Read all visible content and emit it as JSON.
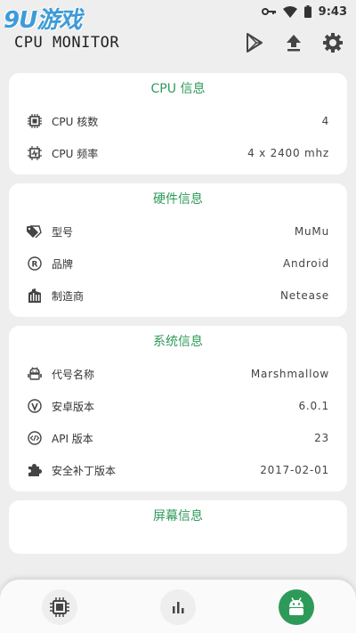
{
  "status_bar": {
    "time": "9:43",
    "icons": [
      "key-icon",
      "wifi-icon",
      "battery-icon"
    ]
  },
  "watermark": {
    "text": "9U游戏"
  },
  "app_bar": {
    "title": "CPU MONITOR",
    "actions": [
      "play-store-icon",
      "upload-icon",
      "settings-icon"
    ]
  },
  "cards": {
    "cpu": {
      "title": "CPU 信息",
      "rows": [
        {
          "icon": "cpu-chip-icon",
          "label": "CPU 核数",
          "value": "4"
        },
        {
          "icon": "cpu-frequency-icon",
          "label": "CPU 频率",
          "value": "4 x 2400 mhz"
        }
      ]
    },
    "hardware": {
      "title": "硬件信息",
      "rows": [
        {
          "icon": "tag-icon",
          "label": "型号",
          "value": "MuMu"
        },
        {
          "icon": "registered-icon",
          "label": "品牌",
          "value": "Android"
        },
        {
          "icon": "building-icon",
          "label": "制造商",
          "value": "Netease"
        }
      ]
    },
    "system": {
      "title": "系统信息",
      "rows": [
        {
          "icon": "android-icon",
          "label": "代号名称",
          "value": "Marshmallow"
        },
        {
          "icon": "android-version-icon",
          "label": "安卓版本",
          "value": "6.0.1"
        },
        {
          "icon": "code-icon",
          "label": "API 版本",
          "value": "23"
        },
        {
          "icon": "puzzle-icon",
          "label": "安全补丁版本",
          "value": "2017-02-01"
        }
      ]
    },
    "screen": {
      "title": "屏幕信息"
    }
  },
  "bottom_nav": {
    "items": [
      {
        "icon": "cpu-chip-icon",
        "active": false
      },
      {
        "icon": "bar-chart-icon",
        "active": false
      },
      {
        "icon": "android-icon",
        "active": true
      }
    ]
  },
  "colors": {
    "accent": "#2e9a5a",
    "background": "#eeeeee",
    "card": "#ffffff"
  }
}
